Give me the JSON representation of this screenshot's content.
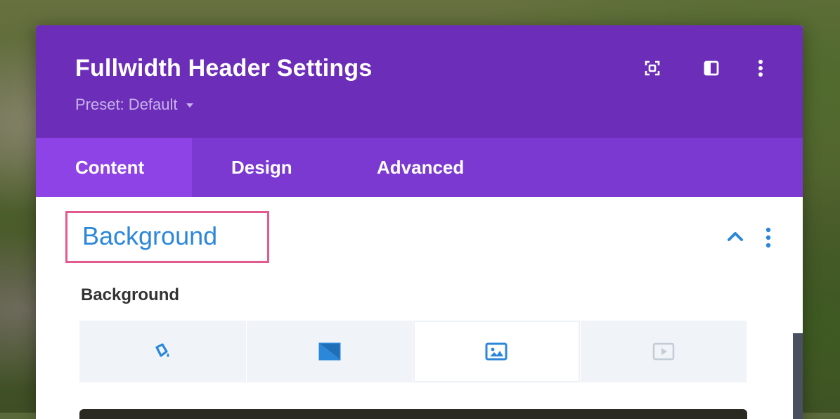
{
  "window": {
    "title": "Fullwidth Header Settings",
    "preset_label": "Preset: Default",
    "header_icons": [
      "focus-mode-icon",
      "split-view-icon",
      "more-options-icon"
    ]
  },
  "tabs": [
    {
      "label": "Content",
      "active": true
    },
    {
      "label": "Design",
      "active": false
    },
    {
      "label": "Advanced",
      "active": false
    }
  ],
  "section": {
    "title": "Background",
    "expanded": true,
    "field_label": "Background",
    "background_types": [
      {
        "icon": "color-fill-icon",
        "active": false
      },
      {
        "icon": "gradient-icon",
        "active": false
      },
      {
        "icon": "image-icon",
        "active": true
      },
      {
        "icon": "video-icon",
        "active": false
      }
    ]
  },
  "colors": {
    "header": "#6c2eb9",
    "tab_bar": "#7b39d1",
    "active_tab": "#8e43e6",
    "accent": "#2b87da",
    "highlight": "#e25b8f"
  }
}
